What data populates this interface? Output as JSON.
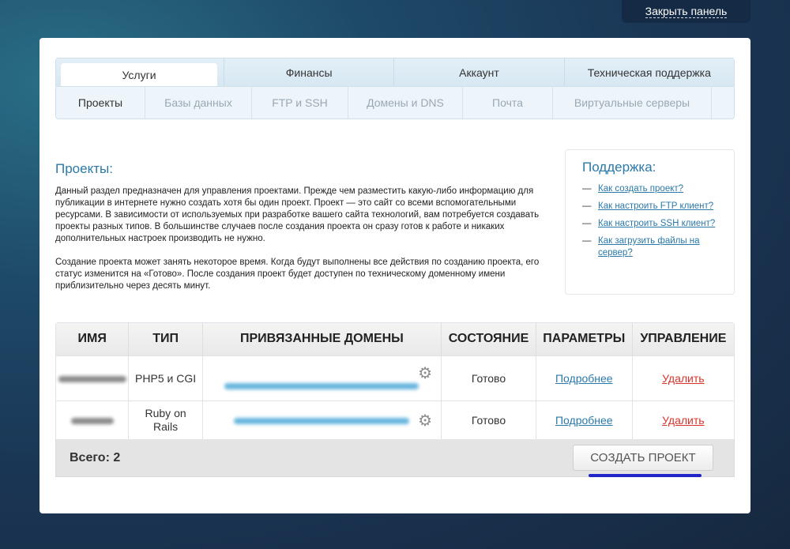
{
  "top_panel": {
    "close_label": "Закрыть панель"
  },
  "nav": {
    "main_tabs": [
      "Услуги",
      "Финансы",
      "Аккаунт",
      "Техническая поддержка"
    ],
    "sub_tabs": [
      "Проекты",
      "Базы данных",
      "FTP и SSH",
      "Домены и DNS",
      "Почта",
      "Виртуальные серверы"
    ]
  },
  "section": {
    "title": "Проекты:",
    "paragraph1": "Данный раздел предназначен для управления проектами. Прежде чем разместить какую-либо информацию для публикации в интернете нужно создать хотя бы один проект. Проект — это сайт со всеми вспомогательными ресурсами. В зависимости от используемых при разработке вашего сайта технологий, вам потребуется создавать проекты разных типов. В большинстве случаев после создания проекта он сразу готов к работе и никаких дополнительных настроек производить не нужно.",
    "paragraph2": "Создание проекта может занять некоторое время. Когда будут выполнены все действия по созданию проекта, его статус изменится на «Готово». После создания проект будет доступен по техническому доменному имени приблизительно через десять минут."
  },
  "support": {
    "title": "Поддержка:",
    "links": [
      "Как создать проект?",
      "Как настроить FTP клиент?",
      "Как настроить SSH клиент?",
      "Как загрузить файлы на сервер?"
    ]
  },
  "table": {
    "headers": [
      "ИМЯ",
      "ТИП",
      "ПРИВЯЗАННЫЕ ДОМЕНЫ",
      "СОСТОЯНИЕ",
      "ПАРАМЕТРЫ",
      "УПРАВЛЕНИЕ"
    ],
    "rows": [
      {
        "type": "PHP5 и CGI",
        "status": "Готово",
        "params": "Подробнее",
        "action": "Удалить"
      },
      {
        "type_line1": "Ruby on",
        "type_line2": "Rails",
        "status": "Готово",
        "params": "Подробнее",
        "action": "Удалить"
      }
    ]
  },
  "footer": {
    "total": "Всего: 2",
    "create_label": "СОЗДАТЬ ПРОЕКТ"
  },
  "colors": {
    "accent": "#2a79a8",
    "danger": "#d9342b",
    "highlight": "#1f25c9"
  },
  "icons": {
    "row_settings": "gear-icon"
  }
}
